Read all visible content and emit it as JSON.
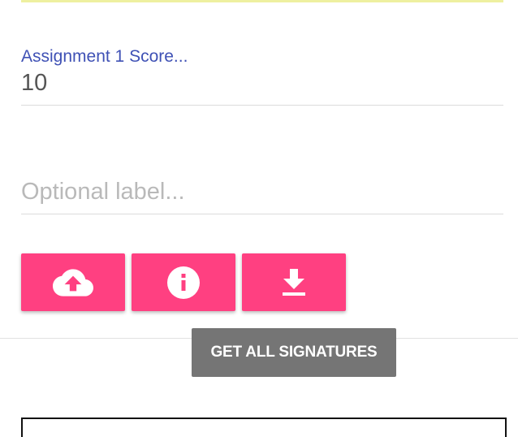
{
  "colors": {
    "accent": "#ff4081",
    "label": "#3f51b5",
    "tooltip_bg": "#757575",
    "top_underline": "#eef0a0"
  },
  "score_field": {
    "label": "Assignment 1 Score...",
    "value": "10"
  },
  "optional_field": {
    "value": "",
    "placeholder": "Optional label..."
  },
  "buttons": {
    "upload": {
      "icon": "cloud-upload-icon"
    },
    "info": {
      "icon": "info-icon"
    },
    "download": {
      "icon": "download-icon"
    }
  },
  "tooltip": {
    "text": "GET ALL SIGNATURES"
  }
}
